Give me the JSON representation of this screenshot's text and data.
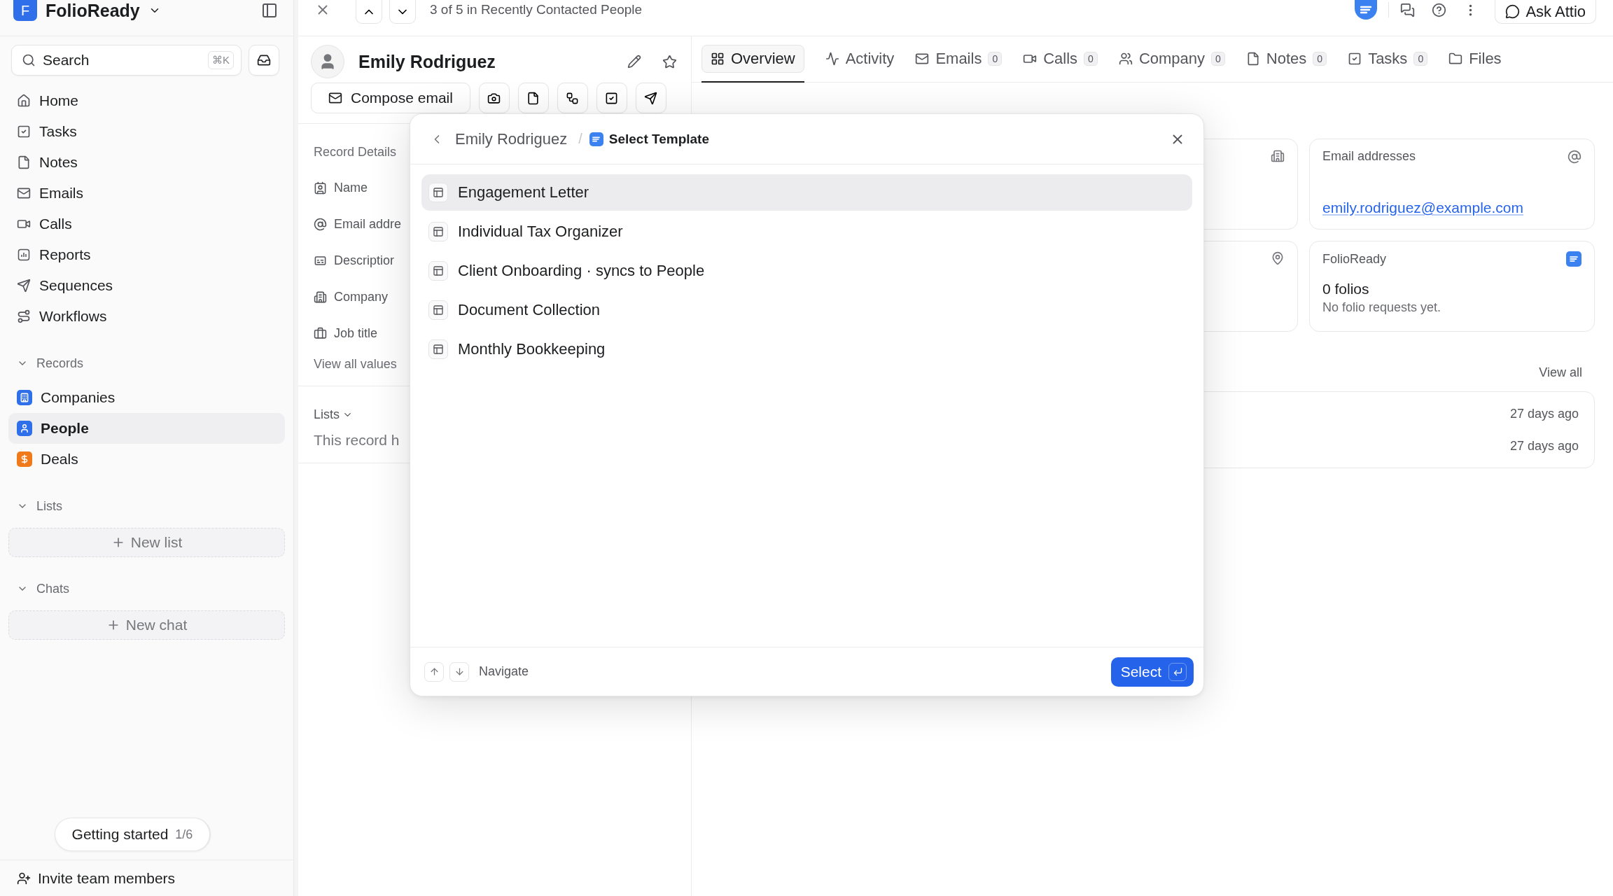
{
  "sidebar": {
    "workspace": "FolioReady",
    "logo_letter": "F",
    "search": {
      "placeholder": "Search",
      "shortcut": "⌘K"
    },
    "nav": [
      {
        "label": "Home"
      },
      {
        "label": "Tasks"
      },
      {
        "label": "Notes"
      },
      {
        "label": "Emails"
      },
      {
        "label": "Calls"
      },
      {
        "label": "Reports"
      },
      {
        "label": "Sequences"
      },
      {
        "label": "Workflows"
      }
    ],
    "records": {
      "title": "Records",
      "items": [
        {
          "label": "Companies",
          "color": "#2f6fea",
          "selected": false
        },
        {
          "label": "People",
          "color": "#2f6fea",
          "selected": true
        },
        {
          "label": "Deals",
          "color": "#f07a1a",
          "selected": false
        }
      ]
    },
    "lists": {
      "title": "Lists",
      "new_label": "New list"
    },
    "chats": {
      "title": "Chats",
      "new_label": "New chat"
    },
    "getting_started": {
      "label": "Getting started",
      "progress": "1/6"
    },
    "invite": "Invite team members"
  },
  "topbar": {
    "position": "3 of 5 in Recently Contacted People",
    "ask": "Ask Attio"
  },
  "record": {
    "name": "Emily Rodriguez",
    "compose": "Compose email",
    "details_title": "Record Details",
    "fields": [
      "Name",
      "Email addre",
      "Descriptior",
      "Company",
      "Job title"
    ],
    "view_all": "View all values",
    "lists_title": "Lists",
    "lists_empty": "This record h"
  },
  "tabs": [
    {
      "label": "Overview",
      "selected": true
    },
    {
      "label": "Activity",
      "selected": false
    },
    {
      "label": "Emails",
      "count": "0",
      "selected": false
    },
    {
      "label": "Calls",
      "count": "0",
      "selected": false
    },
    {
      "label": "Company",
      "count": "0",
      "selected": false
    },
    {
      "label": "Notes",
      "count": "0",
      "selected": false
    },
    {
      "label": "Tasks",
      "count": "0",
      "selected": false
    },
    {
      "label": "Files",
      "selected": false
    }
  ],
  "overview": {
    "email_card": {
      "title": "Email addresses",
      "value": "emily.rodriguez@example.com"
    },
    "folio_card": {
      "title": "FolioReady",
      "count": "0 folios",
      "note": "No folio requests yet."
    },
    "view_all": "View all",
    "activity_times": [
      "27 days ago",
      "27 days ago"
    ]
  },
  "modal": {
    "breadcrumb": "Emily Rodriguez",
    "separator": "/",
    "title": "Select Template",
    "items": [
      {
        "label": "Engagement Letter",
        "selected": true
      },
      {
        "label": "Individual Tax Organizer",
        "selected": false
      },
      {
        "label": "Client Onboarding · syncs to People",
        "selected": false
      },
      {
        "label": "Document Collection",
        "selected": false
      },
      {
        "label": "Monthly Bookkeeping",
        "selected": false
      }
    ],
    "hint": "Navigate",
    "select": "Select"
  }
}
